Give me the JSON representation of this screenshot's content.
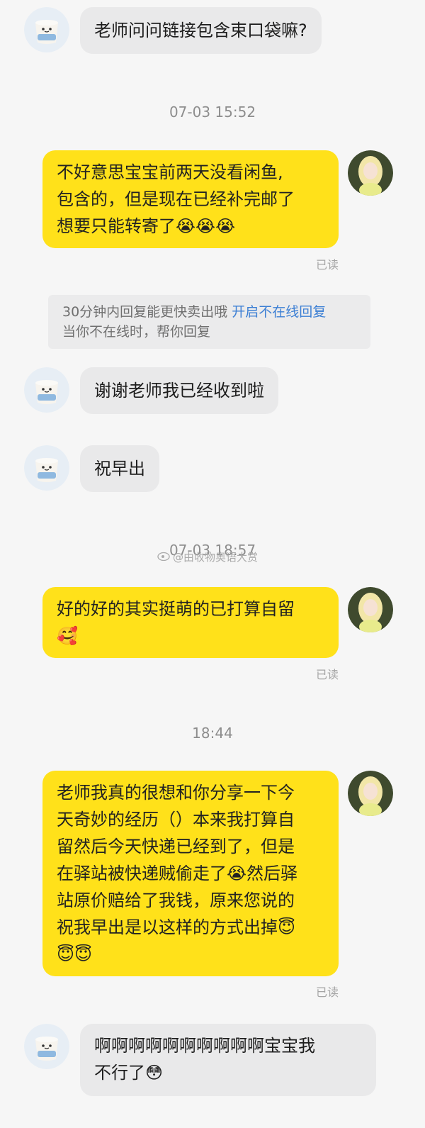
{
  "messages": [
    {
      "side": "left",
      "text": "老师问问链接包含束口袋嘛?"
    },
    {
      "time": "07-03 15:52"
    },
    {
      "side": "right",
      "text": "不好意思宝宝前两天没看闲鱼,\n包含的，但是现在已经补完邮了\n想要只能转寄了😭😭😭",
      "status": "已读"
    },
    {
      "side": "left",
      "text": "谢谢老师我已经收到啦"
    },
    {
      "side": "left",
      "text": "祝早出"
    },
    {
      "time": "07-03 18:57"
    },
    {
      "side": "right",
      "text": "好的好的其实挺萌的已打算自留\n🥰",
      "status": "已读"
    },
    {
      "time": "18:44"
    },
    {
      "side": "right",
      "text": "老师我真的很想和你分享一下今\n天奇妙的经历（）本来我打算自\n留然后今天快递已经到了，但是\n在驿站被快递贼偷走了😭然后驿\n站原价赔给了我钱，原来您说的\n祝我早出是以这样的方式出掉😇\n😇😇",
      "status": "已读"
    },
    {
      "side": "left",
      "text": "啊啊啊啊啊啊啊啊啊啊宝宝我\n不行了😳"
    }
  ],
  "notice": {
    "line1": "30分钟内回复能更快卖出哦",
    "link": "开启不在线回复",
    "line2": "当你不在线时，帮你回复"
  },
  "watermark": "@由收物奥语大赏",
  "colors": {
    "bubble_self": "#ffe11a",
    "bubble_other": "#e9e9ea",
    "link": "#3c7fd4",
    "background": "#f6f6f6"
  },
  "icons": {
    "left_avatar": "yogurt-cup-avatar-icon",
    "right_avatar": "blonde-doll-avatar-icon"
  }
}
